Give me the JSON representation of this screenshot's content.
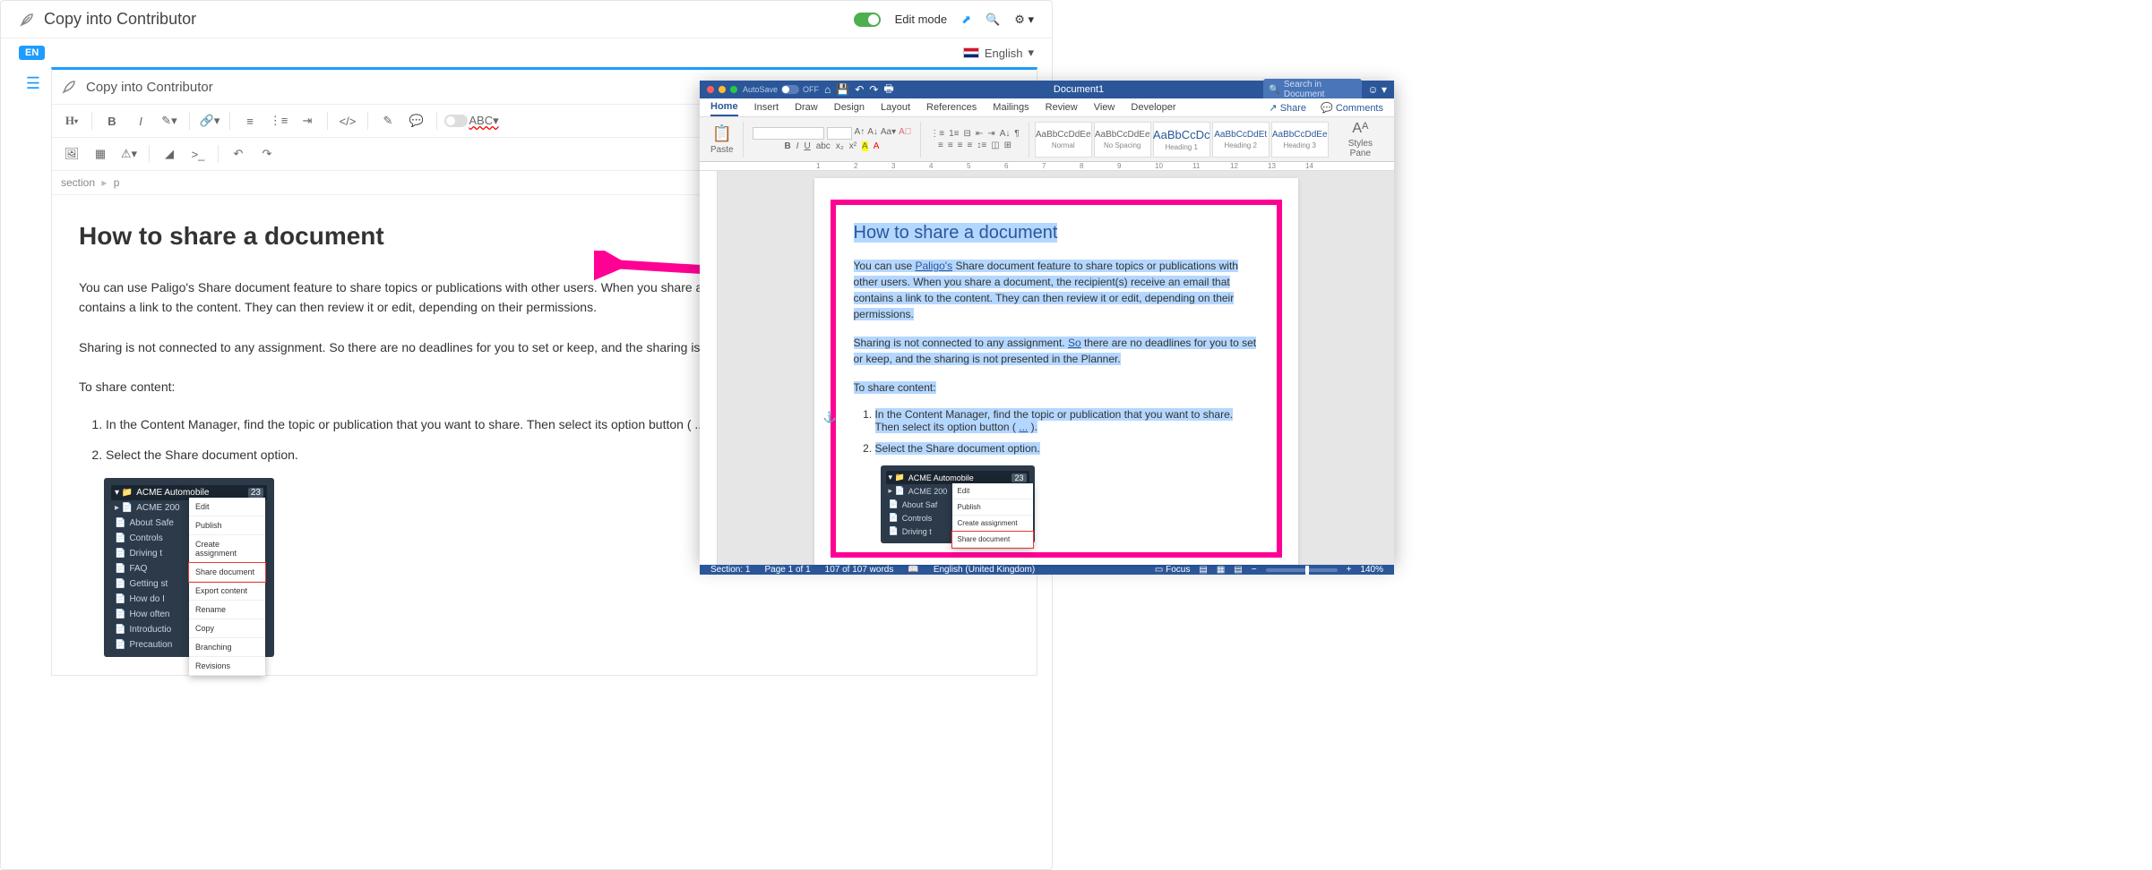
{
  "paligo": {
    "title": "Copy  into Contributor",
    "edit_mode": "Edit mode",
    "lang_badge": "EN",
    "lang_label": "English",
    "editor_title": "Copy  into Contributor",
    "breadcrumb": {
      "a": "section",
      "b": "p"
    },
    "heading": "How to share a document",
    "p1": "You can use Paligo's Share document feature to share topics or publications with other users. When you share a document, the recipient(s) receive an email that contains a link to the content. They can then review it or edit, depending on their permissions.",
    "p2": "Sharing is not connected to any assignment. So there are no deadlines for you to set or keep, and the sharing is not presented in the Planner.",
    "p3": "To share content:",
    "li1": "In the Content Manager, find the topic or publication that you want to share. Then select its option button ( ... ).",
    "li2": "Select the Share document option.",
    "cm": {
      "root": "ACME Automobile",
      "badge": "23",
      "items": [
        "ACME 200",
        "About Safe",
        "Controls",
        "Driving t",
        "FAQ",
        "Getting st",
        "How do I",
        "How often",
        "Introductio",
        "Precaution"
      ],
      "menu": [
        "Edit",
        "Publish",
        "Create assignment",
        "Share document",
        "Export content",
        "Rename",
        "Copy",
        "Branching",
        "Revisions"
      ]
    }
  },
  "word": {
    "doc_title": "Document1",
    "autosave_label": "AutoSave",
    "autosave_state": "OFF",
    "search_ph": "Search in Document",
    "tabs": [
      "Home",
      "Insert",
      "Draw",
      "Design",
      "Layout",
      "References",
      "Mailings",
      "Review",
      "View",
      "Developer"
    ],
    "share": "Share",
    "comments": "Comments",
    "paste": "Paste",
    "styles": [
      {
        "preview": "AaBbCcDdEe",
        "name": "Normal"
      },
      {
        "preview": "AaBbCcDdEe",
        "name": "No Spacing"
      },
      {
        "preview": "AaBbCcDc",
        "name": "Heading 1"
      },
      {
        "preview": "AaBbCcDdEt",
        "name": "Heading 2"
      },
      {
        "preview": "AaBbCcDdEe",
        "name": "Heading 3"
      }
    ],
    "styles_pane": "Styles Pane",
    "ruler": [
      "1",
      "2",
      "3",
      "4",
      "5",
      "6",
      "7",
      "8",
      "9",
      "10",
      "11",
      "12",
      "13",
      "14"
    ],
    "heading": "How to share a document",
    "p1a": "You can use ",
    "p1_link": "Paligo's",
    "p1b": " Share document feature to share topics or publications with other users. When you share a document, the recipient(s) receive an email that contains a link to the content. They can then review it or edit, depending on their permissions.",
    "p2a": "Sharing is not connected to any assignment. ",
    "p2_link": "So",
    "p2b": " there are no deadlines for you to set or keep, and the sharing is not presented in the Planner.",
    "p3": "To share content:",
    "li1a": "In the Content Manager, find the topic or publication that you want to share. Then select its option button ( ",
    "li1_link": "...",
    "li1b": " ).",
    "li2": "Select the Share document option.",
    "cm": {
      "root": "ACME Automobile",
      "badge": "23",
      "items": [
        "ACME 200",
        "About Saf",
        "Controls",
        "Driving t"
      ],
      "menu": [
        "Edit",
        "Publish",
        "Create assignment",
        "Share document"
      ]
    },
    "status": {
      "section": "Section: 1",
      "page": "Page 1 of 1",
      "words": "107 of 107 words",
      "lang": "English (United Kingdom)",
      "focus": "Focus",
      "zoom": "140%"
    }
  }
}
